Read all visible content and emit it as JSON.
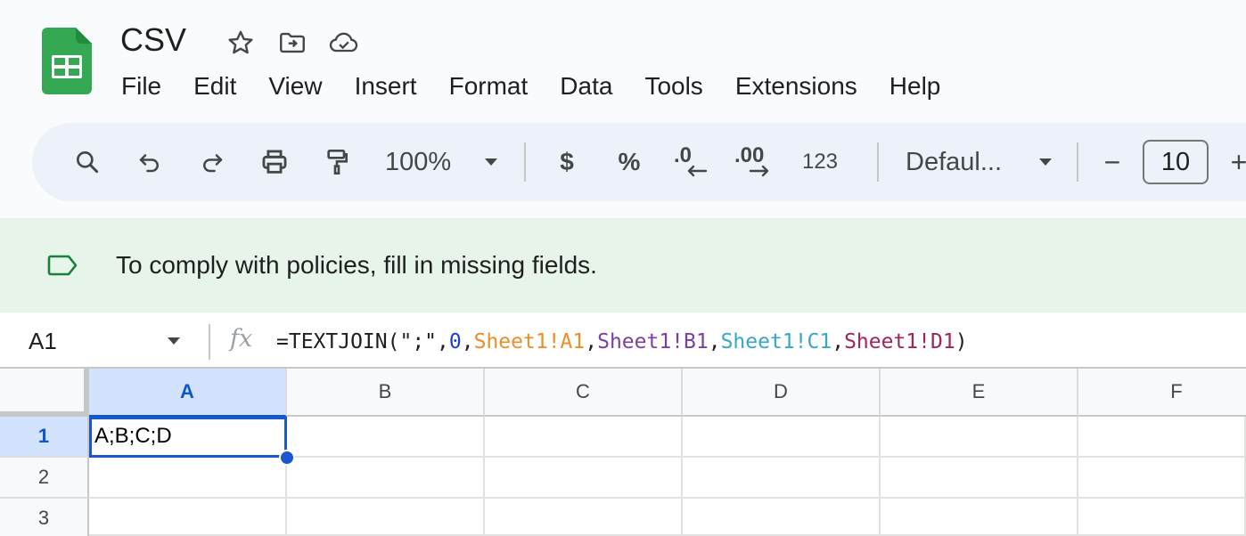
{
  "document": {
    "title": "CSV"
  },
  "menu": [
    "File",
    "Edit",
    "View",
    "Insert",
    "Format",
    "Data",
    "Tools",
    "Extensions",
    "Help"
  ],
  "toolbar": {
    "zoom": "100%",
    "currency_label": "$",
    "percent_label": "%",
    "decrease_decimal_label": ".0",
    "increase_decimal_label": ".00",
    "number_format_label": "123",
    "font_family": "Defaul...",
    "font_size_decrease": "−",
    "font_size": "10",
    "font_size_increase": "+"
  },
  "banner": {
    "message": "To comply with policies, fill in missing fields."
  },
  "formula_bar": {
    "name_box": "A1",
    "fx_label": "fx",
    "formula_parts": [
      {
        "text": "=TEXTJOIN(",
        "kind": "dark"
      },
      {
        "text": "\";\"",
        "kind": "str"
      },
      {
        "text": ",",
        "kind": "dark"
      },
      {
        "text": "0",
        "kind": "num"
      },
      {
        "text": ",",
        "kind": "dark"
      },
      {
        "text": "Sheet1!A1",
        "kind": "r1"
      },
      {
        "text": ",",
        "kind": "dark"
      },
      {
        "text": "Sheet1!B1",
        "kind": "r2"
      },
      {
        "text": ",",
        "kind": "dark"
      },
      {
        "text": "Sheet1!C1",
        "kind": "r3"
      },
      {
        "text": ",",
        "kind": "dark"
      },
      {
        "text": "Sheet1!D1",
        "kind": "r4"
      },
      {
        "text": ")",
        "kind": "dark"
      }
    ]
  },
  "sheet": {
    "columns": [
      "A",
      "B",
      "C",
      "D",
      "E",
      "F"
    ],
    "rows": [
      "1",
      "2",
      "3"
    ],
    "active_column": "A",
    "active_row": "1",
    "cells": {
      "A1": "A;B;C;D"
    }
  },
  "colors": {
    "accent": "#0b57d0",
    "selection": "#1a56cf",
    "banner_bg": "#e6f4ea",
    "sheets_green": "#34a853"
  }
}
